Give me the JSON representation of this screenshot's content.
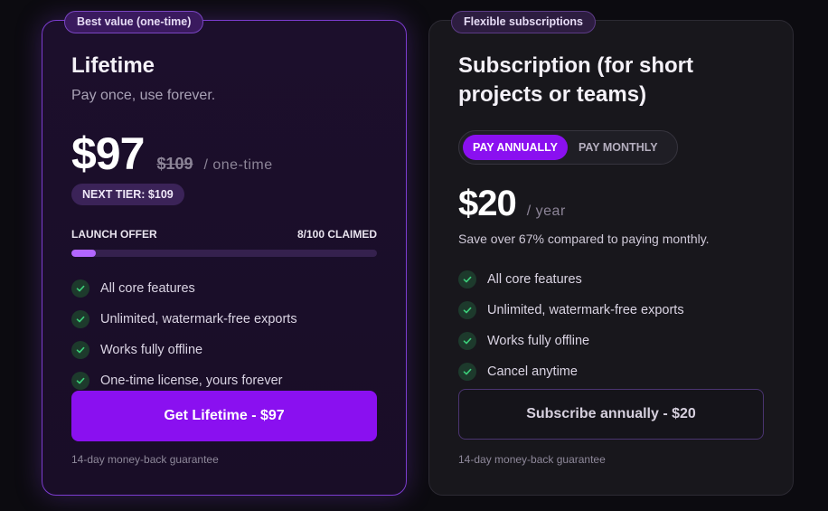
{
  "lifetime": {
    "badge": "Best value (one-time)",
    "title": "Lifetime",
    "subtitle": "Pay once, use forever.",
    "price": "$97",
    "old_price": "$109",
    "period": "/ one-time",
    "next_tier": "NEXT TIER: $109",
    "progress_label": "LAUNCH OFFER",
    "progress_count": "8/100 CLAIMED",
    "progress_value": 0.08,
    "features": [
      "All core features",
      "Unlimited, watermark-free exports",
      "Works fully offline",
      "One-time license, yours forever"
    ],
    "cta": "Get Lifetime - $97",
    "guarantee": "14-day money-back guarantee"
  },
  "subscription": {
    "badge": "Flexible subscriptions",
    "title_line1": "Subscription (for short",
    "title_line2": "projects or teams)",
    "toggle": {
      "annual": "PAY ANNUALLY",
      "monthly": "PAY MONTHLY",
      "selected": "annual"
    },
    "price": "$20",
    "period": "/ year",
    "save_note": "Save over 67% compared to paying monthly.",
    "features": [
      "All core features",
      "Unlimited, watermark-free exports",
      "Works fully offline",
      "Cancel anytime"
    ],
    "cta": "Subscribe annually - $20",
    "guarantee": "14-day money-back guarantee"
  },
  "icons": {
    "feature_check": "check-icon"
  },
  "colors": {
    "accent": "#8a10f0",
    "progress_fill": "#b266ff",
    "check": "#3ccf7a"
  }
}
